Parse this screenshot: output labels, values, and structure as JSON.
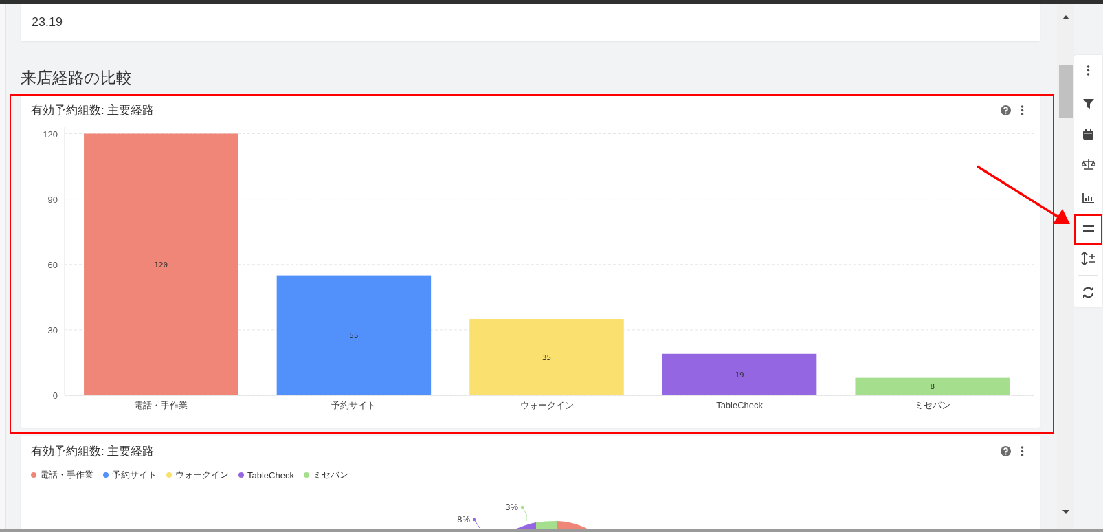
{
  "summary_card": {
    "value": "23.19"
  },
  "section_title": "来店経路の比較",
  "bar_card": {
    "title": "有効予約組数: 主要経路",
    "chart_data": {
      "type": "bar",
      "categories": [
        "電話・手作業",
        "予約サイト",
        "ウォークイン",
        "TableCheck",
        "ミセバン"
      ],
      "series": [
        {
          "color": "#ef8677",
          "values": [
            120,
            null,
            null,
            null,
            null
          ]
        },
        {
          "color": "#5291fb",
          "values": [
            null,
            55,
            null,
            null,
            null
          ]
        },
        {
          "color": "#fae06e",
          "values": [
            null,
            null,
            35,
            null,
            null
          ]
        },
        {
          "color": "#9566e2",
          "values": [
            null,
            null,
            null,
            19,
            null
          ]
        },
        {
          "color": "#a5de8d",
          "values": [
            null,
            null,
            null,
            null,
            8
          ]
        }
      ],
      "stacked": true,
      "ylim": [
        0,
        123
      ],
      "yticks": [
        0,
        30,
        60,
        90,
        120
      ],
      "grid": true,
      "data_labels": true
    }
  },
  "pie_card": {
    "title": "有効予約組数: 主要経路",
    "legend": [
      {
        "label": "電話・手作業",
        "color": "#ef8677"
      },
      {
        "label": "予約サイト",
        "color": "#5291fb"
      },
      {
        "label": "ウォークイン",
        "color": "#fae06e"
      },
      {
        "label": "TableCheck",
        "color": "#9566e2"
      },
      {
        "label": "ミセバン",
        "color": "#a5de8d"
      }
    ],
    "slice_labels": [
      {
        "text": "8%",
        "color": "#9566e2"
      },
      {
        "text": "3%",
        "color": "#a5de8d"
      }
    ]
  },
  "toolbar": [
    {
      "kind": "menu"
    },
    {
      "kind": "filter"
    },
    {
      "kind": "calendar"
    },
    {
      "kind": "compare"
    },
    {
      "kind": "chart"
    },
    {
      "kind": "equal"
    },
    {
      "kind": "scale"
    },
    {
      "kind": "refresh"
    }
  ]
}
